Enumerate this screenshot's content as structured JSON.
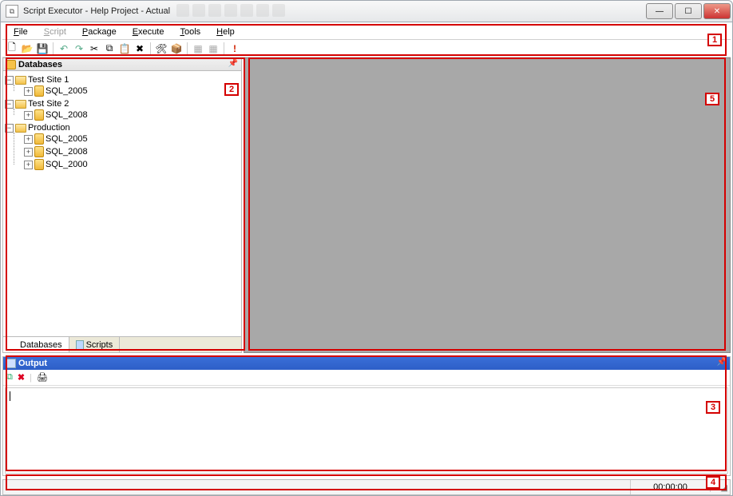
{
  "window": {
    "title": "Script Executor - Help Project - Actual"
  },
  "menu": {
    "file": "File",
    "script": "Script",
    "package": "Package",
    "execute": "Execute",
    "tools": "Tools",
    "help": "Help"
  },
  "toolbar_icons": {
    "new": "new-icon",
    "open": "open-icon",
    "save": "save-icon",
    "undo": "undo-icon",
    "redo": "redo-icon",
    "cut": "cut-icon",
    "copy": "copy-icon",
    "paste": "paste-icon",
    "delete": "delete-icon",
    "options": "options-icon",
    "package": "package-icon",
    "run": "run-icon",
    "stop": "stop-icon",
    "alert": "alert-icon"
  },
  "sidepanel": {
    "title": "Databases",
    "tabs": {
      "databases": "Databases",
      "scripts": "Scripts"
    },
    "tree": [
      {
        "label": "Test Site 1",
        "children": [
          {
            "label": "SQL_2005"
          }
        ]
      },
      {
        "label": "Test Site 2",
        "children": [
          {
            "label": "SQL_2008"
          }
        ]
      },
      {
        "label": "Production",
        "children": [
          {
            "label": "SQL_2005"
          },
          {
            "label": "SQL_2008"
          },
          {
            "label": "SQL_2000"
          }
        ]
      }
    ]
  },
  "output": {
    "title": "Output",
    "content": ""
  },
  "statusbar": {
    "time": "00:00:00"
  },
  "annotations": {
    "r1": "1",
    "r2": "2",
    "r3": "3",
    "r4": "4",
    "r5": "5"
  }
}
